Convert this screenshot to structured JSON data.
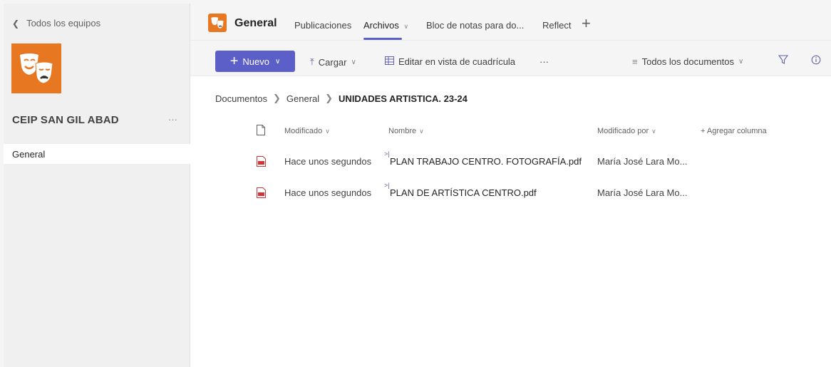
{
  "sidebar": {
    "back_label": "Todos los equipos",
    "team_name": "CEIP SAN GIL ABAD",
    "more_label": "···",
    "channels": [
      {
        "label": "General"
      }
    ]
  },
  "header": {
    "channel_title": "General",
    "tabs": [
      {
        "label": "Publicaciones"
      },
      {
        "label": "Archivos",
        "active": true
      },
      {
        "label": "Bloc de notas para do..."
      },
      {
        "label": "Reflect"
      }
    ],
    "add_tab": "+"
  },
  "toolbar": {
    "new_label": "Nuevo",
    "upload_label": "Cargar",
    "grid_label": "Editar en vista de cuadrícula",
    "more_label": "···",
    "view_label": "Todos los documentos"
  },
  "breadcrumb": [
    "Documentos",
    "General",
    "UNIDADES ARTISTICA. 23-24"
  ],
  "table": {
    "columns": {
      "modified": "Modificado",
      "name": "Nombre",
      "modified_by": "Modificado por",
      "add_column": "+ Agregar columna"
    },
    "rows": [
      {
        "modified": "Hace unos segundos",
        "name": "PLAN TRABAJO CENTRO. FOTOGRAFÍA.pdf",
        "modified_by": "María José Lara Mo..."
      },
      {
        "modified": "Hace unos segundos",
        "name": "PLAN DE ARTÍSTICA CENTRO.pdf",
        "modified_by": "María José Lara Mo..."
      }
    ]
  },
  "colors": {
    "accent": "#5b5fc7",
    "team_orange": "#e87722",
    "pdf_red": "#d13438"
  },
  "icons": [
    "chevron-left-icon",
    "theater-masks-icon",
    "upload-icon",
    "grid-icon",
    "filter-icon",
    "info-icon",
    "file-icon",
    "pdf-icon"
  ]
}
